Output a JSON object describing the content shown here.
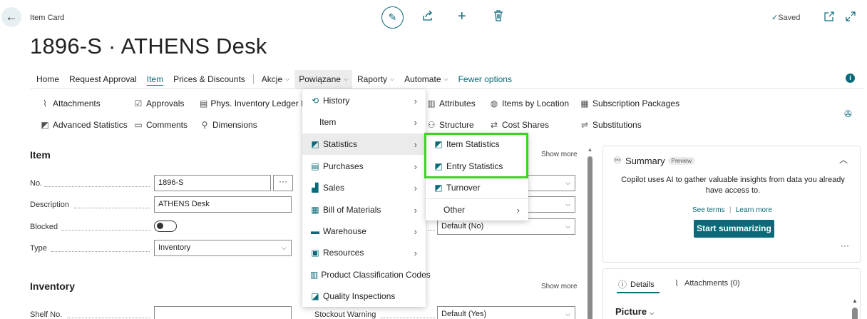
{
  "header": {
    "breadcrumb": "Item Card",
    "title": "1896-S · ATHENS Desk",
    "saved_status": "Saved"
  },
  "action_bar": {
    "home": "Home",
    "request_approval": "Request Approval",
    "item": "Item",
    "prices_discounts": "Prices & Discounts",
    "akcje": "Akcje",
    "powiazane": "Powiązane",
    "raporty": "Raporty",
    "automate": "Automate",
    "fewer_options": "Fewer options"
  },
  "ribbon": {
    "attachments": "Attachments",
    "approvals": "Approvals",
    "phys_inventory": "Phys. Inventory Ledger Ent",
    "attributes": "Attributes",
    "items_by_location": "Items by Location",
    "subscription_packages": "Subscription Packages",
    "advanced_statistics": "Advanced Statistics",
    "comments": "Comments",
    "dimensions": "Dimensions",
    "structure": "Structure",
    "cost_shares": "Cost Shares",
    "substitutions": "Substitutions"
  },
  "item_section": {
    "title": "Item",
    "show_more": "Show more",
    "no_label": "No.",
    "no_value": "1896-S",
    "description_label": "Description",
    "description_value": "ATHENS Desk",
    "blocked_label": "Blocked",
    "type_label": "Type",
    "type_value": "Inventory",
    "right_field_value": "Default (No)"
  },
  "inventory_section": {
    "title": "Inventory",
    "show_more": "Show more",
    "shelf_label": "Shelf No.",
    "stockout_label": "Stockout Warning",
    "stockout_value": "Default (Yes)"
  },
  "powiazane_menu": {
    "history": "History",
    "item": "Item",
    "statistics": "Statistics",
    "purchases": "Purchases",
    "sales": "Sales",
    "bill_of_materials": "Bill of Materials",
    "warehouse": "Warehouse",
    "resources": "Resources",
    "product_classification": "Product Classification Codes",
    "quality_inspections": "Quality Inspections"
  },
  "statistics_submenu": {
    "item_statistics": "Item Statistics",
    "entry_statistics": "Entry Statistics",
    "turnover": "Turnover",
    "other": "Other"
  },
  "summary": {
    "title": "Summary",
    "badge": "Preview",
    "text": "Copilot uses AI to gather valuable insights from data you already have access to.",
    "see_terms": "See terms",
    "learn_more": "Learn more",
    "start_button": "Start summarizing",
    "more": "···"
  },
  "details_pane": {
    "details_tab": "Details",
    "attachments_tab": "Attachments (0)",
    "picture": "Picture"
  },
  "colors": {
    "accent": "#0b6a77",
    "highlight_border": "#3dd421"
  }
}
